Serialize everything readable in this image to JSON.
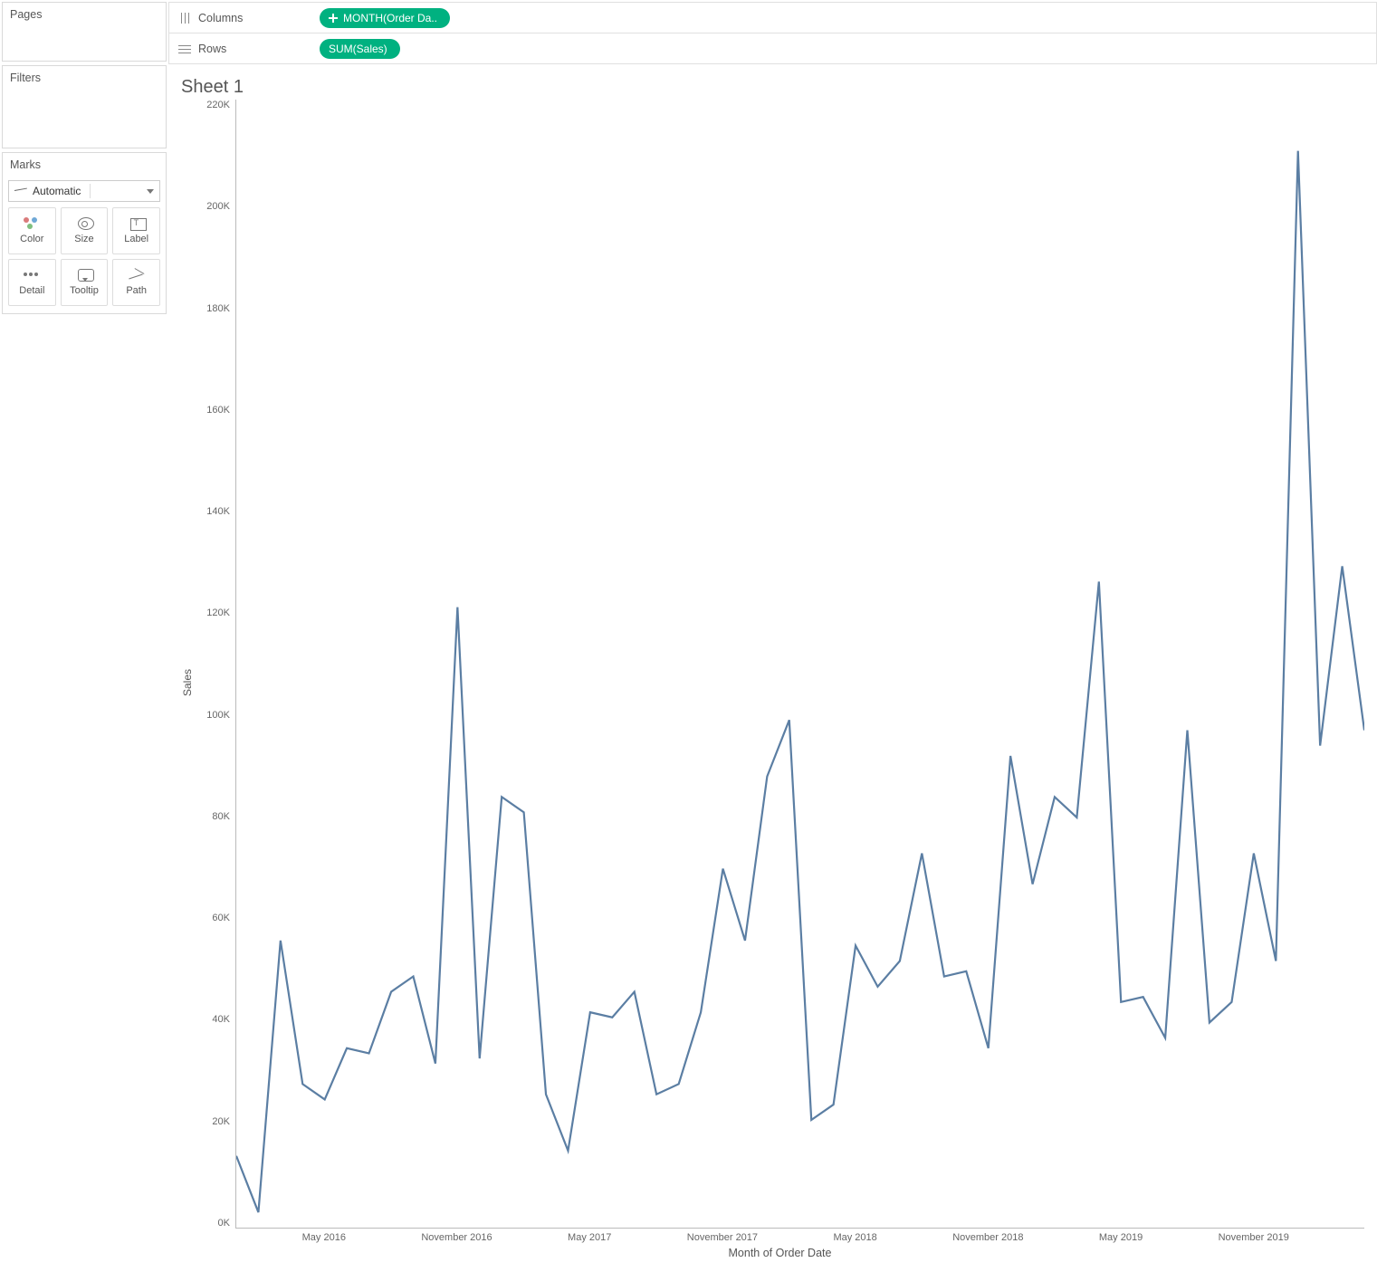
{
  "panels": {
    "pages_label": "Pages",
    "filters_label": "Filters",
    "marks_label": "Marks",
    "mark_type": "Automatic",
    "shelves": {
      "color": "Color",
      "size": "Size",
      "label": "Label",
      "detail": "Detail",
      "tooltip": "Tooltip",
      "path": "Path"
    }
  },
  "shelf": {
    "columns_label": "Columns",
    "rows_label": "Rows",
    "columns_pill": "MONTH(Order Da..",
    "rows_pill": "SUM(Sales)"
  },
  "viz": {
    "title": "Sheet 1",
    "yaxis_title": "Sales",
    "xaxis_title": "Month of Order Date"
  },
  "chart_data": {
    "type": "line",
    "title": "Sheet 1",
    "xlabel": "Month of Order Date",
    "ylabel": "Sales",
    "ylim": [
      0,
      220000
    ],
    "ytick_values": [
      0,
      20000,
      40000,
      60000,
      80000,
      100000,
      120000,
      140000,
      160000,
      180000,
      200000,
      220000
    ],
    "ytick_labels": [
      "0K",
      "20K",
      "40K",
      "60K",
      "80K",
      "100K",
      "120K",
      "140K",
      "160K",
      "180K",
      "200K",
      "220K"
    ],
    "xtick_labels": [
      "May 2016",
      "November 2016",
      "May 2017",
      "November 2017",
      "May 2018",
      "November 2018",
      "May 2019",
      "November 2019"
    ],
    "xtick_positions": [
      4,
      10,
      16,
      22,
      28,
      34,
      40,
      46
    ],
    "x": [
      "Jan 2016",
      "Feb 2016",
      "Mar 2016",
      "Apr 2016",
      "May 2016",
      "Jun 2016",
      "Jul 2016",
      "Aug 2016",
      "Sep 2016",
      "Oct 2016",
      "Nov 2016",
      "Dec 2016",
      "Jan 2017",
      "Feb 2017",
      "Mar 2017",
      "Apr 2017",
      "May 2017",
      "Jun 2017",
      "Jul 2017",
      "Aug 2017",
      "Sep 2017",
      "Oct 2017",
      "Nov 2017",
      "Dec 2017",
      "Jan 2018",
      "Feb 2018",
      "Mar 2018",
      "Apr 2018",
      "May 2018",
      "Jun 2018",
      "Jul 2018",
      "Aug 2018",
      "Sep 2018",
      "Oct 2018",
      "Nov 2018",
      "Dec 2018",
      "Jan 2019",
      "Feb 2019",
      "Mar 2019",
      "Apr 2019",
      "May 2019",
      "Jun 2019",
      "Jul 2019",
      "Aug 2019",
      "Sep 2019",
      "Oct 2019",
      "Nov 2019",
      "Dec 2019"
    ],
    "values": [
      14000,
      3000,
      56000,
      28000,
      25000,
      35000,
      34000,
      46000,
      49000,
      32000,
      121000,
      33000,
      84000,
      81000,
      26000,
      15000,
      42000,
      41000,
      46000,
      26000,
      28000,
      42000,
      70000,
      56000,
      88000,
      99000,
      21000,
      24000,
      55000,
      47000,
      52000,
      73000,
      49000,
      50000,
      35000,
      92000,
      67000,
      84000,
      80000,
      126000,
      44000,
      45000,
      37000,
      97000,
      40000,
      44000,
      73000,
      52000
    ],
    "tail_x": [
      "Jan 2020",
      "Feb 2020",
      "Mar 2020",
      "Apr 2020"
    ],
    "tail_values": [
      210000,
      94000,
      129000,
      97000
    ]
  }
}
